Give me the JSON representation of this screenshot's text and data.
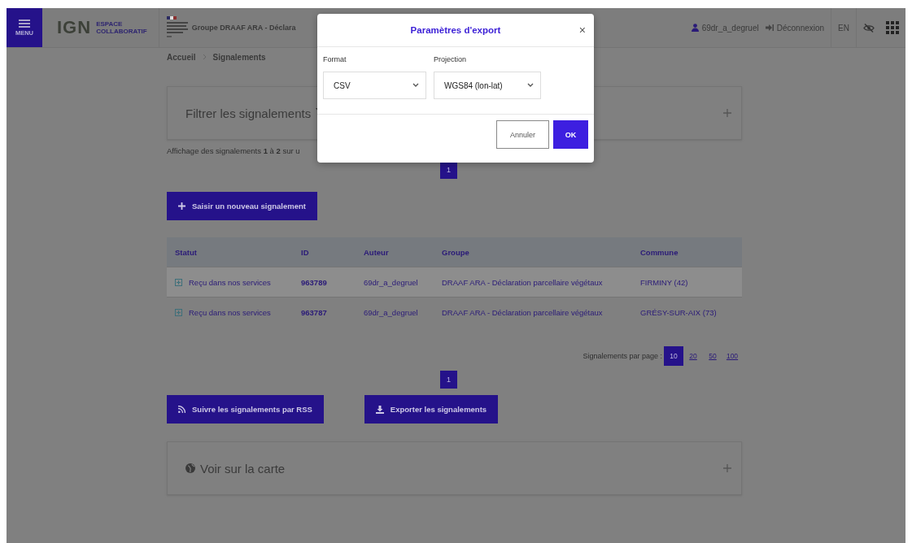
{
  "header": {
    "menu_label": "MENU",
    "logo": "IGN",
    "logo_sub_1": "ESPACE",
    "logo_sub_2": "COLLABORATIF",
    "group": "Groupe DRAAF ARA - Déclara",
    "user": "69dr_a_degruel",
    "logout": "Déconnexion",
    "language": "EN"
  },
  "breadcrumb": [
    {
      "label": "Accueil"
    },
    {
      "label": "Signalements"
    }
  ],
  "filter_panel": {
    "title": "Filtrer les signalements"
  },
  "summary": "Affichage des signalements **1** à **2** sur u",
  "pagination_top": [
    {
      "label": "1",
      "selected": true
    }
  ],
  "new_button": "Saisir un nouveau signalement",
  "table": {
    "columns": [
      "Statut",
      "ID",
      "Auteur",
      "Groupe",
      "Commune"
    ],
    "rows": [
      {
        "status": "Reçu dans nos services",
        "id": "963789",
        "author": "69dr_a_degruel",
        "group": "DRAAF ARA - Déclaration parcellaire végétaux",
        "commune": "FIRMINY (42)",
        "highlighted": true
      },
      {
        "status": "Reçu dans nos services",
        "id": "963787",
        "author": "69dr_a_degruel",
        "group": "DRAAF ARA - Déclaration parcellaire végétaux",
        "commune": "GRÉSY-SUR-AIX (73)",
        "highlighted": false
      }
    ]
  },
  "per_page": {
    "label": "Signalements par page :",
    "options": [
      {
        "label": "10",
        "selected": true
      },
      {
        "label": "20",
        "selected": false
      },
      {
        "label": "50",
        "selected": false
      },
      {
        "label": "100",
        "selected": false
      }
    ]
  },
  "pagination_bottom": [
    {
      "label": "1",
      "selected": true
    }
  ],
  "rss_button": "Suivre les signalements par RSS",
  "export_button": "Exporter les signalements",
  "map_panel": {
    "title": "Voir sur la carte"
  },
  "modal": {
    "title": "Paramètres d'export",
    "close": "×",
    "format_label": "Format",
    "format_value": "CSV",
    "projection_label": "Projection",
    "projection_value": "WGS84 (lon-lat)",
    "cancel": "Annuler",
    "ok": "OK"
  }
}
